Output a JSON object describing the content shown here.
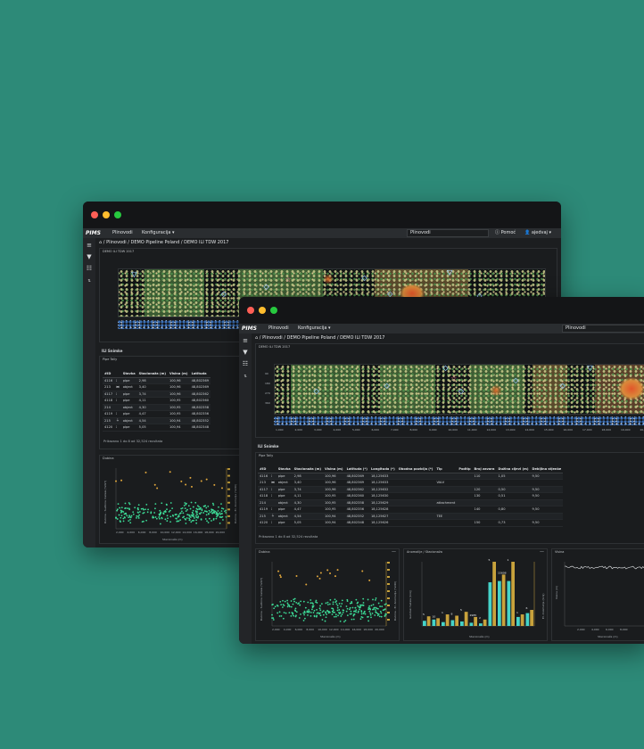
{
  "app": {
    "logo": "PIMS",
    "nav_pipelines": "Plinovodi",
    "nav_config": "Konfiguracija ▾",
    "select_pipelines": "Plinovodi",
    "help": "ⓘ Pomoć",
    "user": "👤 ajedvaj ▾"
  },
  "breadcrumb": {
    "home": "⌂",
    "items": [
      "Plinovodi",
      "DEMO Pipeline Poland",
      "DEMO ILI TDW 2017"
    ]
  },
  "heatmap": {
    "title": "DEMO ILI TDW 2017",
    "y_ticks": [
      "90",
      "180",
      "270",
      "360"
    ],
    "x_ticks": [
      "1,000",
      "2,000",
      "3,000",
      "4,000",
      "5,000",
      "6,000",
      "7,000",
      "8,000",
      "9,000",
      "10,000",
      "11,000",
      "12,000",
      "13,000",
      "14,000",
      "15,000",
      "16,000",
      "17,000",
      "18,000",
      "19,000",
      "20,000"
    ]
  },
  "ili_section": "ILI Snimke",
  "pipe_tally": {
    "title": "Pipe Tally",
    "columns_back": [
      "#ID",
      "",
      "Stavka",
      "Stacionaža (m)",
      "Visina (m)",
      "Latituda"
    ],
    "columns_front": [
      "#ID",
      "",
      "Stavka",
      "Stacionaža (m)",
      "Visina (m)",
      "Latituda (*)",
      "Longituda (*)",
      "Obodna pozicija (*)",
      "Tip",
      "Podtip",
      "Broj zavara",
      "Dužina cijevi (m)",
      "Debljina stjenke"
    ],
    "rows": [
      {
        "id": "4116",
        "icon": "⁞",
        "item": "pipe",
        "station": "2,98",
        "height": "100,96",
        "lat": "48,802369",
        "lon": "18,125633",
        "clock": "",
        "type": "",
        "subtype": "",
        "welds": "110",
        "length": "1,05",
        "wall": "9,50"
      },
      {
        "id": "213",
        "icon": "⧓",
        "item": "object",
        "station": "3,40",
        "height": "100,96",
        "lat": "48,802369",
        "lon": "18,125633",
        "clock": "",
        "type": "VALV",
        "subtype": "",
        "welds": "",
        "length": "",
        "wall": ""
      },
      {
        "id": "4117",
        "icon": "⁞",
        "item": "pipe",
        "station": "3,74",
        "height": "100,96",
        "lat": "48,802362",
        "lon": "18,125632",
        "clock": "",
        "type": "",
        "subtype": "",
        "welds": "120",
        "length": "0,50",
        "wall": "9,50"
      },
      {
        "id": "4118",
        "icon": "⁞",
        "item": "pipe",
        "station": "4,11",
        "height": "100,95",
        "lat": "48,802360",
        "lon": "18,125630",
        "clock": "",
        "type": "",
        "subtype": "",
        "welds": "130",
        "length": "0,51",
        "wall": "9,50"
      },
      {
        "id": "214",
        "icon": "",
        "item": "object",
        "station": "4,30",
        "height": "100,95",
        "lat": "48,802358",
        "lon": "18,125629",
        "clock": "",
        "type": "attachment",
        "subtype": "",
        "welds": "",
        "length": "",
        "wall": ""
      },
      {
        "id": "4119",
        "icon": "⁞",
        "item": "pipe",
        "station": "4,47",
        "height": "100,95",
        "lat": "48,802356",
        "lon": "18,125628",
        "clock": "",
        "type": "",
        "subtype": "",
        "welds": "140",
        "length": "0,80",
        "wall": "9,50"
      },
      {
        "id": "215",
        "icon": "⏚",
        "item": "object",
        "station": "4,54",
        "height": "100,94",
        "lat": "48,802352",
        "lon": "18,125627",
        "clock": "",
        "type": "TEE",
        "subtype": "",
        "welds": "",
        "length": "",
        "wall": ""
      },
      {
        "id": "4120",
        "icon": "⁞",
        "item": "pipe",
        "station": "5,05",
        "height": "100,94",
        "lat": "48,802348",
        "lon": "18,125626",
        "clock": "",
        "type": "",
        "subtype": "",
        "welds": "150",
        "length": "0,73",
        "wall": "9,50"
      }
    ],
    "summary": "Prikazano 1 do 8 od 32,524 rezultata"
  },
  "panels": {
    "depth_title": "Dubina",
    "depth_ylabel": "Dubina - Sudbina metala (%WT)",
    "depth_ylabel2": "Dubina - El. Anomalija (%OD)",
    "depth_xlabel": "Stacionaža (m)",
    "depth_x_ticks": [
      "2,000",
      "4,000",
      "6,000",
      "8,000",
      "10,000",
      "12,000",
      "14,000",
      "16,000",
      "18,000",
      "20,000"
    ],
    "anom_title": "Anomalije / Stacionaža",
    "anom_ylabel": "Gubitak metala (broj)",
    "anom_ylabel2": "El. Anomalija (broj)",
    "anom_xlabel": "Stacionaža (m)",
    "height_title": "Visina",
    "height_ylabel": "Visina (m)",
    "height_xlabel": "Stacionaža (m)",
    "height_x_ticks": [
      "2,000",
      "4,000",
      "6,000",
      "8,000"
    ],
    "menu_icon": "—"
  },
  "chart_data": [
    {
      "type": "bar",
      "title": "Anomalije / Stacionaža",
      "xlabel": "Stacionaža (m)",
      "ylabel": "Gubitak metala (broj)",
      "categories": [
        "1",
        "2",
        "3",
        "4",
        "5",
        "6",
        "7",
        "8",
        "9",
        "10",
        "11",
        "12"
      ],
      "series": [
        {
          "name": "",
          "values": [
            8,
            10,
            6,
            9,
            7,
            5,
            4,
            68,
            70,
            70,
            14,
            20
          ],
          "color": "#45d3c8"
        },
        {
          "name": "",
          "values": [
            15,
            12,
            18,
            16,
            22,
            14,
            10,
            100,
            80,
            100,
            18,
            25
          ],
          "color": "#c8a23c"
        }
      ],
      "data_labels": [
        "5",
        "10",
        "1",
        "8",
        "5",
        "2985",
        "2",
        "5",
        "15608",
        "1",
        "1",
        "6"
      ]
    }
  ],
  "colors": {
    "background": "#2d8a78",
    "window": "#1c1e20",
    "scatter_green": "#3ddc97",
    "scatter_orange": "#e0a63c",
    "bar_cyan": "#45d3c8",
    "bar_gold": "#c8a23c"
  }
}
